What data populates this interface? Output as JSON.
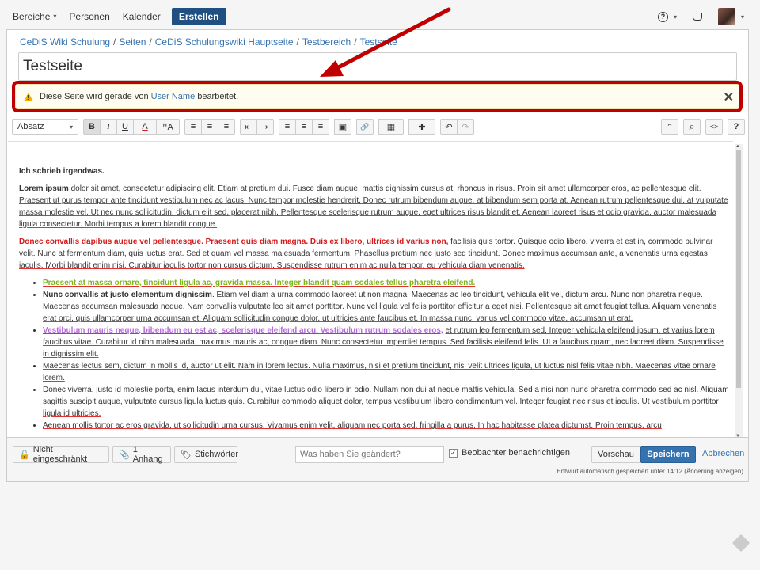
{
  "nav": {
    "items": [
      {
        "label": "Bereiche",
        "caret": true
      },
      {
        "label": "Personen",
        "caret": false
      },
      {
        "label": "Kalender",
        "caret": false
      }
    ],
    "create_label": "Erstellen",
    "help_glyph": "?",
    "caret_glyph": "▾"
  },
  "breadcrumb": [
    "CeDiS Wiki Schulung",
    "Seiten",
    "CeDiS Schulungswiki Hauptseite",
    "Testbereich",
    "Testseite"
  ],
  "breadcrumb_sep": "/",
  "page_title": "Testseite",
  "warning": {
    "before": "Diese Seite wird gerade von",
    "user": "User Name",
    "after": "bearbeitet.",
    "close": "✕"
  },
  "toolbar": {
    "paragraph": "Absatz",
    "caret": "▾",
    "bold": "B",
    "italic": "I",
    "underline": "U",
    "color": "A",
    "clear": "ꟸA",
    "bullets": "≡",
    "numbered": "≡",
    "tasks": "≡",
    "outdent": "⇤",
    "indent": "⇥",
    "align_left": "≡",
    "align_center": "≡",
    "align_right": "≡",
    "layout": "▣",
    "link": "🔗",
    "table": "▦",
    "insert": "✚",
    "undo": "↶",
    "redo": "↷",
    "collapse": "⌃",
    "find": "⌕",
    "source": "<>",
    "help": "?"
  },
  "content": {
    "heading": "Ich schrieb irgendwas.",
    "p1_lead": "Lorem ipsum",
    "p1": "dolor sit amet, consectetur adipiscing elit. Etiam at pretium dui. Fusce diam augue, mattis dignissim cursus at, rhoncus in risus. Proin sit amet ullamcorper eros, ac pellentesque elit. Praesent ut purus tempor ante tincidunt vestibulum nec ac lacus. Nunc tempor molestie hendrerit. Donec rutrum bibendum augue, at bibendum sem porta at. Aenean rutrum pellentesque dui, at vulputate massa molestie vel. Ut nec nunc sollicitudin, dictum elit sed, placerat nibh. Pellentesque scelerisque rutrum augue, eget ultrices risus blandit et. Aenean laoreet risus et odio gravida, auctor malesuada ligula consectetur. Morbi tempus a lorem blandit congue.",
    "p2_red": "Donec convallis dapibus augue vel pellentesque. Praesent quis diam magna. Duis ex libero, ultrices id varius non,",
    "p2": "facilisis quis tortor. Quisque odio libero, viverra et est in, commodo pulvinar velit. Nunc at fermentum diam, quis luctus erat. Sed et quam vel massa malesuada fermentum. Phasellus pretium nec justo sed tincidunt. Donec maximus accumsan ante, a venenatis urna egestas iaculis. Morbi blandit enim nisi. Curabitur iaculis tortor non cursus dictum. Suspendisse rutrum enim ac nulla tempor, eu vehicula diam venenatis.",
    "li1_green": "Praesent at massa ornare, tincidunt ligula ac, gravida massa. Integer blandit quam sodales tellus pharetra eleifend.",
    "li2_bold": "Nunc convallis at justo elementum dignissim",
    "li2": ". Etiam vel diam a urna commodo laoreet ut non magna. Maecenas ac leo tincidunt, vehicula elit vel, dictum arcu. Nunc non pharetra neque. Maecenas accumsan malesuada neque. Nam convallis vulputate leo sit amet porttitor. Nunc vel ligula vel felis porttitor efficitur a eget nisi. Pellentesque sit amet feugiat tellus. Aliquam venenatis erat orci, quis ullamcorper urna accumsan et. Aliquam sollicitudin congue dolor, ut ultricies ante faucibus et. In massa nunc, varius vel commodo vitae, accumsan ut erat.",
    "li3_purple": "Vestibulum mauris neque, bibendum eu est ac, scelerisque eleifend arcu. Vestibulum rutrum sodales eros,",
    "li3": "et rutrum leo fermentum sed. Integer vehicula eleifend ipsum, et varius lorem faucibus vitae. Curabitur id nibh malesuada, maximus mauris ac, congue diam. Nunc consectetur imperdiet tempus. Sed facilisis eleifend felis. Ut a faucibus quam, nec laoreet diam. Suspendisse in dignissim elit.",
    "li4": "Maecenas lectus sem, dictum in mollis id, auctor ut elit. Nam in lorem lectus. Nulla maximus, nisi et pretium tincidunt, nisl velit ultrices ligula, ut luctus nisl felis vitae nibh. Maecenas vitae ornare lorem.",
    "li5": "Donec viverra, justo id molestie porta, enim lacus interdum dui, vitae luctus odio libero in odio. Nullam non dui at neque mattis vehicula. Sed a nisi non nunc pharetra commodo sed ac nisl. Aliquam sagittis suscipit augue, vulputate cursus ligula luctus quis. Curabitur commodo aliquet dolor, tempus vestibulum libero condimentum vel. Integer feugiat nec risus et iaculis. Ut vestibulum porttitor ligula id ultricies.",
    "li6": "Aenean mollis tortor ac eros gravida, ut sollicitudin urna cursus. Vivamus enim velit, aliquam nec porta sed, fringilla a purus. In hac habitasse platea dictumst. Proin tempus, arcu"
  },
  "bottom": {
    "restrictions": "Nicht eingeschränkt",
    "attachments": "1 Anhang",
    "labels": "Stichwörter",
    "comment_placeholder": "Was haben Sie geändert?",
    "notify_checked": "✓",
    "notify_label": "Beobachter benachrichtigen",
    "preview": "Vorschau",
    "save": "Speichern",
    "cancel": "Abbrechen",
    "autosave": "Entwurf automatisch gespeichert unter 14:12 (Änderung anzeigen)"
  },
  "colors": {
    "brand": "#205081",
    "link": "#3572b0",
    "highlight_border": "#c00000",
    "red_text": "#d41a1a",
    "green_text": "#7cb518",
    "purple_text": "#b46cd6"
  }
}
